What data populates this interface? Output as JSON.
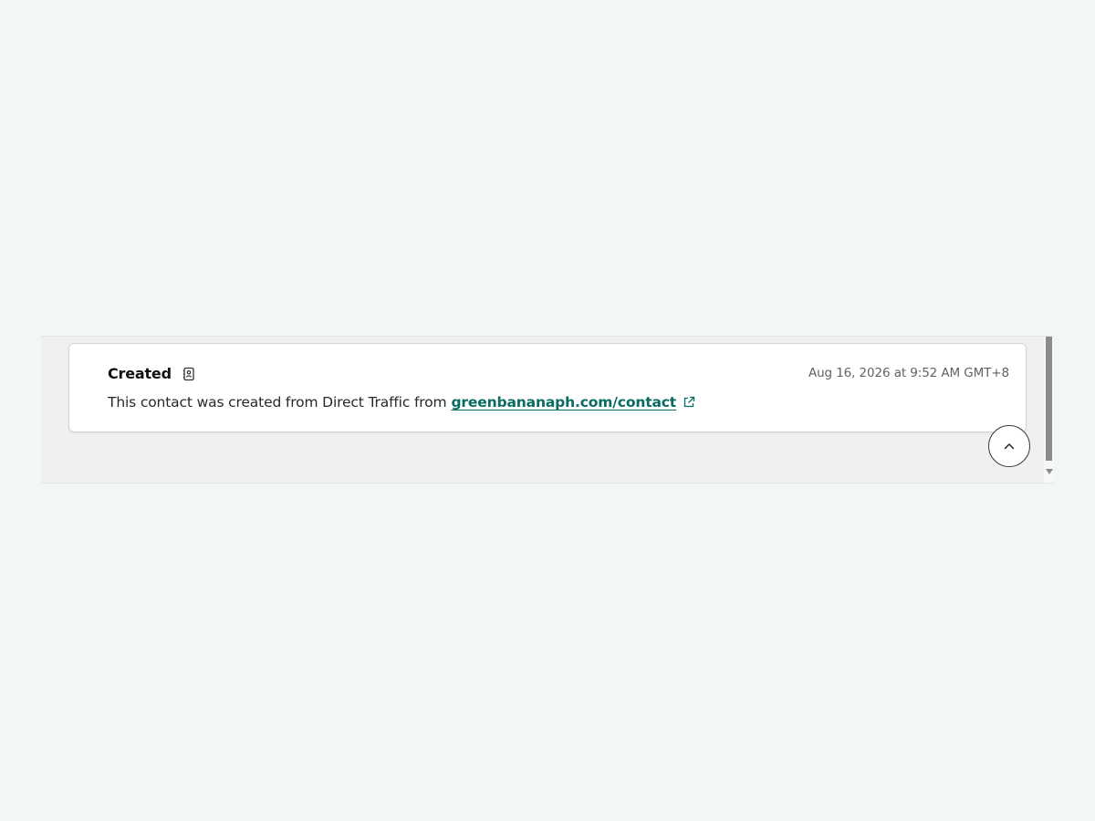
{
  "activity": {
    "title": "Created",
    "title_icon": "contact-book-icon",
    "timestamp": "Aug 16, 2026 at 9:52 AM GMT+8",
    "description_prefix": "This contact was created from Direct Traffic from",
    "link_text": "greenbananaph.com/contact",
    "link_icon": "external-link-icon"
  },
  "controls": {
    "scroll_top_icon": "chevron-up-icon"
  },
  "colors": {
    "link": "#0a6b63",
    "panel_bg": "#f0f0f0",
    "page_bg": "#f3f7f4"
  }
}
